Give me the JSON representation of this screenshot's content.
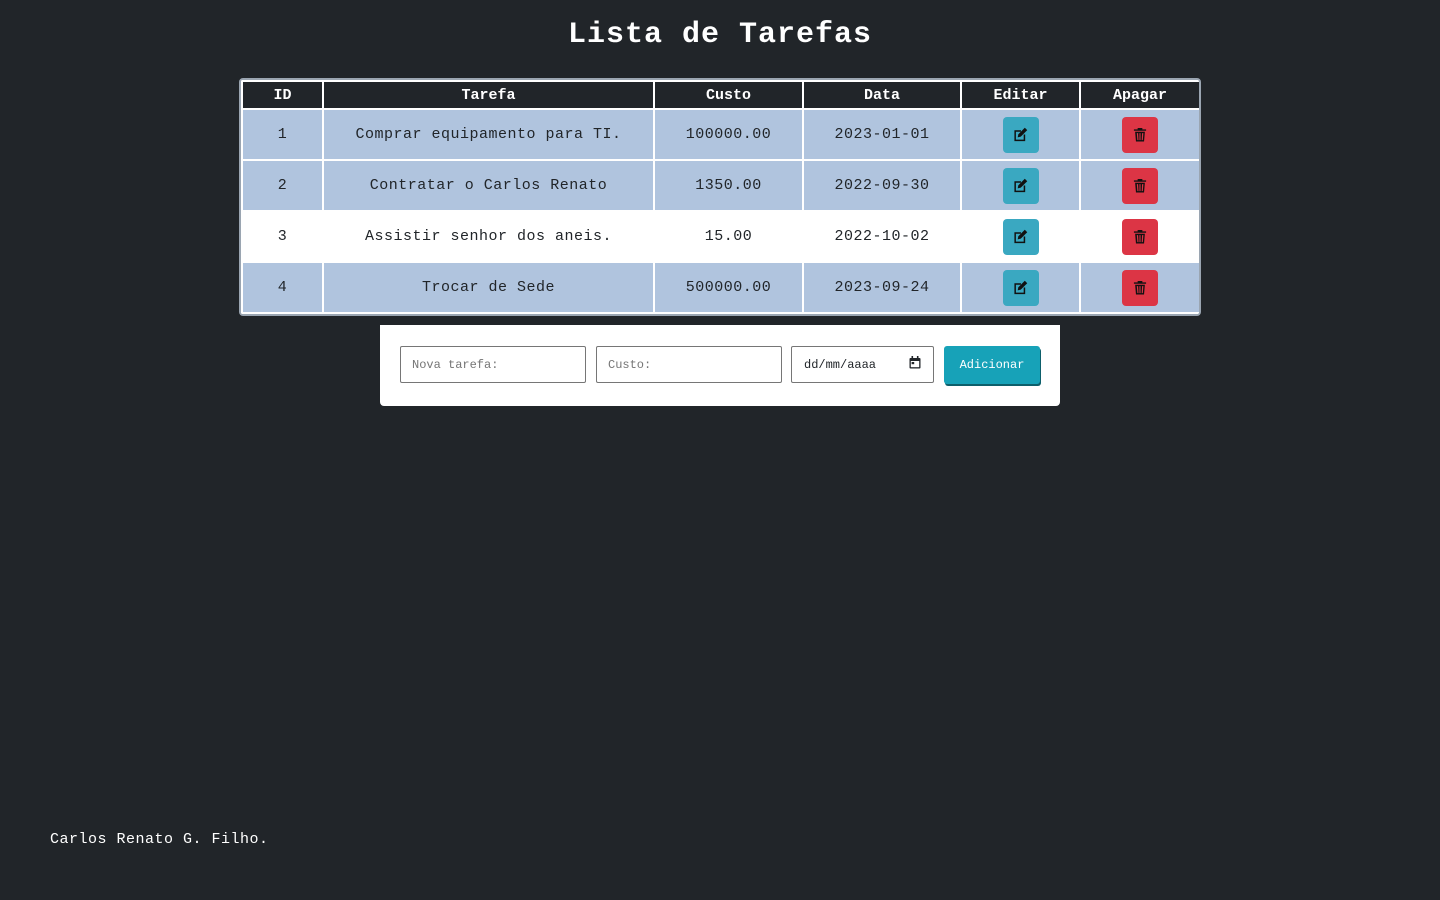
{
  "page": {
    "title": "Lista de Tarefas"
  },
  "table": {
    "headers": {
      "id": "ID",
      "task": "Tarefa",
      "cost": "Custo",
      "date": "Data",
      "edit": "Editar",
      "delete": "Apagar"
    },
    "rows": [
      {
        "id": "1",
        "task": "Comprar equipamento para TI.",
        "cost": "100000.00",
        "date": "2023-01-01",
        "style": "shaded"
      },
      {
        "id": "2",
        "task": "Contratar o Carlos Renato",
        "cost": "1350.00",
        "date": "2022-09-30",
        "style": "shaded"
      },
      {
        "id": "3",
        "task": "Assistir senhor dos aneis.",
        "cost": "15.00",
        "date": "2022-10-02",
        "style": "plain"
      },
      {
        "id": "4",
        "task": "Trocar de Sede",
        "cost": "500000.00",
        "date": "2023-09-24",
        "style": "shaded"
      }
    ],
    "edit_icon": "edit-icon",
    "delete_icon": "trash-icon"
  },
  "form": {
    "task_placeholder": "Nova tarefa:",
    "cost_placeholder": "Custo:",
    "date_placeholder": "dd/mm/aaaa",
    "calendar_icon": "calendar-icon",
    "add_label": "Adicionar"
  },
  "footer": {
    "text": "Carlos Renato G. Filho."
  },
  "colors": {
    "background": "#212529",
    "row_shaded": "#b0c4de",
    "row_plain": "#ffffff",
    "edit_button": "#3aa8c1",
    "delete_button": "#dc3545",
    "add_button": "#17a2b8"
  }
}
